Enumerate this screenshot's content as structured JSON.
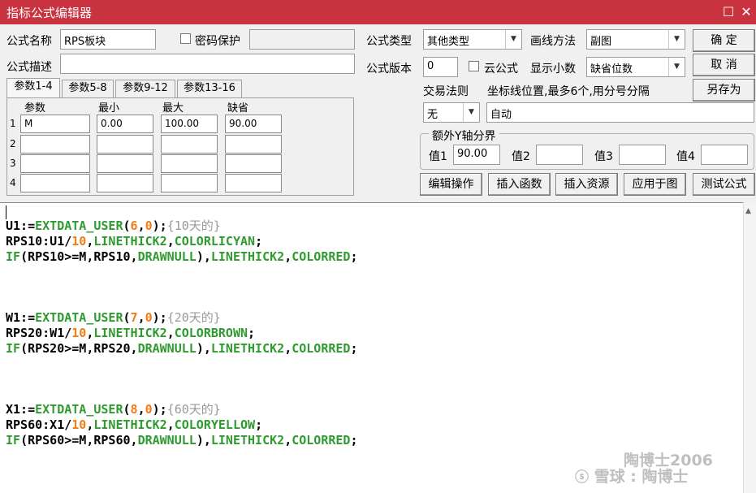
{
  "window": {
    "title": "指标公式编辑器"
  },
  "labels": {
    "name": "公式名称",
    "password": "密码保护",
    "desc": "公式描述",
    "type": "公式类型",
    "drawmethod": "画线方法",
    "version": "公式版本",
    "cloud": "云公式",
    "decimals": "显示小数",
    "trade": "交易法则",
    "coord": "坐标线位置,最多6个,用分号分隔",
    "extra_axis": "额外Y轴分界"
  },
  "fields": {
    "name": "RPS板块",
    "password": "",
    "desc": "",
    "type": "其他类型",
    "drawmethod": "副图",
    "version": "0",
    "decimals": "缺省位数",
    "trade": "无",
    "coord": "自动"
  },
  "buttons": {
    "ok": "确 定",
    "cancel": "取 消",
    "saveas": "另存为",
    "edit": "编辑操作",
    "insert_func": "插入函数",
    "insert_res": "插入资源",
    "apply": "应用于图",
    "test": "测试公式"
  },
  "tabs": [
    "参数1-4",
    "参数5-8",
    "参数9-12",
    "参数13-16"
  ],
  "grid": {
    "headers": [
      "参数",
      "最小",
      "最大",
      "缺省"
    ],
    "rows": [
      {
        "num": "1",
        "cells": [
          "M",
          "0.00",
          "100.00",
          "90.00"
        ]
      },
      {
        "num": "2",
        "cells": [
          "",
          "",
          "",
          ""
        ]
      },
      {
        "num": "3",
        "cells": [
          "",
          "",
          "",
          ""
        ]
      },
      {
        "num": "4",
        "cells": [
          "",
          "",
          "",
          ""
        ]
      }
    ]
  },
  "axis": {
    "l1": "值1",
    "v1": "90.00",
    "l2": "值2",
    "v2": "",
    "l3": "值3",
    "v3": "",
    "l4": "值4",
    "v4": ""
  },
  "code": {
    "u1_a": "U1:=",
    "u1_b": "EXTDATA_USER",
    "u1_c": "(",
    "u1_d": "6",
    "u1_e": ",",
    "u1_f": "0",
    "u1_g": ");",
    "u1_h": "{",
    "u1_i": "10",
    "u1_j": "天的}",
    "r10_a": "RPS10:U1/",
    "r10_b": "10",
    ",": ",",
    "r10_c": "LINETHICK2",
    "r10_d": ",",
    "r10_e": "COLORLICYAN",
    "r10_f": ";",
    "i10_a": "IF",
    "i10_b": "(RPS10>=M,RPS10,",
    "i10_c": "DRAWNULL",
    "i10_d": "),",
    "i10_e": "LINETHICK2",
    "i10_f": ",",
    "i10_g": "COLORRED",
    "i10_h": ";",
    "w1_a": "W1:=",
    "w1_b": "EXTDATA_USER",
    "w1_c": "(",
    "w1_d": "7",
    "w1_e": ",",
    "w1_f": "0",
    "w1_g": ");",
    "w1_h": "{",
    "w1_i": "20",
    "w1_j": "天的}",
    "r20_a": "RPS20:W1/",
    "r20_b": "10",
    "r20_c": "LINETHICK2",
    "r20_d": ",",
    "r20_e": "COLORBROWN",
    "r20_f": ";",
    "i20_b": "(RPS20>=M,RPS20,",
    "x1_a": "X1:=",
    "x1_d": "8",
    "x1_i": "60",
    "r60_a": "RPS60:X1/",
    "r60_e": "COLORYELLOW",
    "i60_b": "(RPS60>=M,RPS60,"
  },
  "watermark": {
    "line1": "陶博士2006",
    "line2": "雪球 : 陶博士"
  }
}
